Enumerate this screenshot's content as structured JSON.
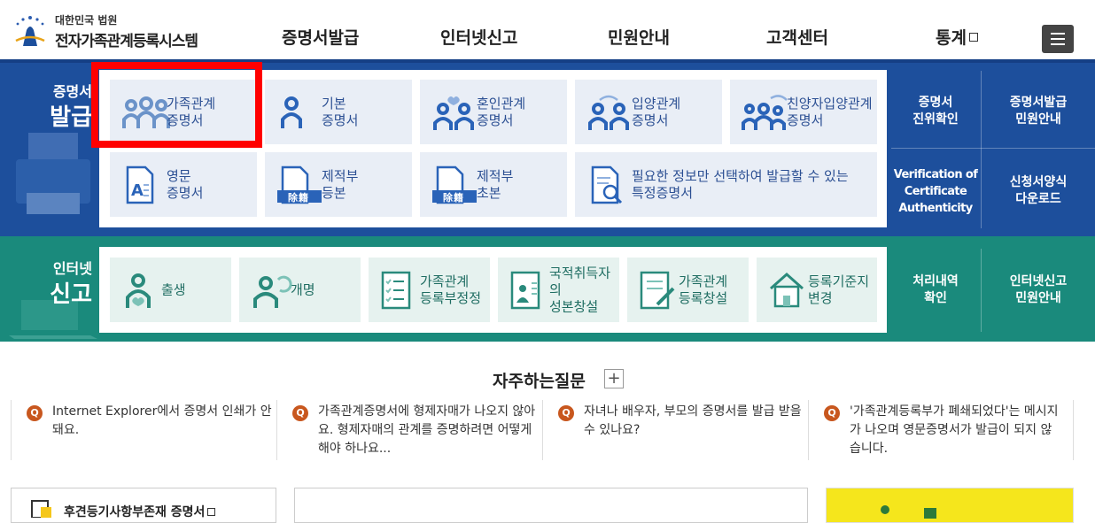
{
  "header": {
    "logo_sub": "대한민국 법원",
    "logo_main": "전자가족관계등록시스템",
    "nav": [
      "증명서발급",
      "인터넷신고",
      "민원안내",
      "고객센터",
      "통계"
    ]
  },
  "issue": {
    "label_small": "증명서",
    "label_big": "발급",
    "tiles": [
      {
        "label": "가족관계\n증명서",
        "icon": "family-icon"
      },
      {
        "label": "기본\n증명서",
        "icon": "person-icon"
      },
      {
        "label": "혼인관계\n증명서",
        "icon": "marriage-icon"
      },
      {
        "label": "입양관계\n증명서",
        "icon": "adoption-icon"
      },
      {
        "label": "친양자입양관계\n증명서",
        "icon": "full-adoption-icon"
      },
      {
        "label": "영문\n증명서",
        "icon": "english-document-icon"
      },
      {
        "label": "제적부\n등본",
        "icon": "removed-register-icon"
      },
      {
        "label": "제적부\n초본",
        "icon": "removed-register-excerpt-icon"
      },
      {
        "label": "필요한 정보만 선택하여 발급할 수 있는\n특정증명서",
        "icon": "document-search-icon"
      }
    ],
    "stamp_text": "除籍",
    "side": [
      "증명서\n진위확인",
      "증명서발급\n민원안내",
      "Verification of\nCertificate\nAuthenticity",
      "신청서양식\n다운로드"
    ]
  },
  "report": {
    "label_small": "인터넷",
    "label_big": "신고",
    "tiles": [
      {
        "label": "출생",
        "icon": "birth-icon"
      },
      {
        "label": "개명",
        "icon": "rename-icon"
      },
      {
        "label": "가족관계\n등록부정정",
        "icon": "register-correction-icon"
      },
      {
        "label": "국적취득자의\n성본창설",
        "icon": "nationality-icon"
      },
      {
        "label": "가족관계\n등록창설",
        "icon": "register-creation-icon"
      },
      {
        "label": "등록기준지\n변경",
        "icon": "home-icon"
      }
    ],
    "side": [
      "처리내역\n확인",
      "인터넷신고\n민원안내"
    ]
  },
  "faq": {
    "title": "자주하는질문",
    "plus": "+",
    "q_mark": "Q",
    "items": [
      "Internet Explorer에서 증명서 인쇄가 안돼요.",
      "가족관계증명서에 형제자매가 나오지 않아요. 형제자매의 관계를 증명하려면 어떻게 해야 하나요...",
      "자녀나 배우자, 부모의 증명서를 발급 받을 수 있나요?",
      "'가족관계등록부가 폐쇄되었다'는 메시지가 나오며 영문증명서가 발급이 되지 않습니다."
    ]
  },
  "bottom": {
    "link_text": "후견등기사항부존재 증명서"
  },
  "colors": {
    "blue_band": "#1d4f9c",
    "green_band": "#1a8a7c",
    "tile_blue": "#e9eef6",
    "tile_green": "#e6f2ef",
    "highlight": "#ff0000",
    "faq_q": "#c8571e"
  }
}
